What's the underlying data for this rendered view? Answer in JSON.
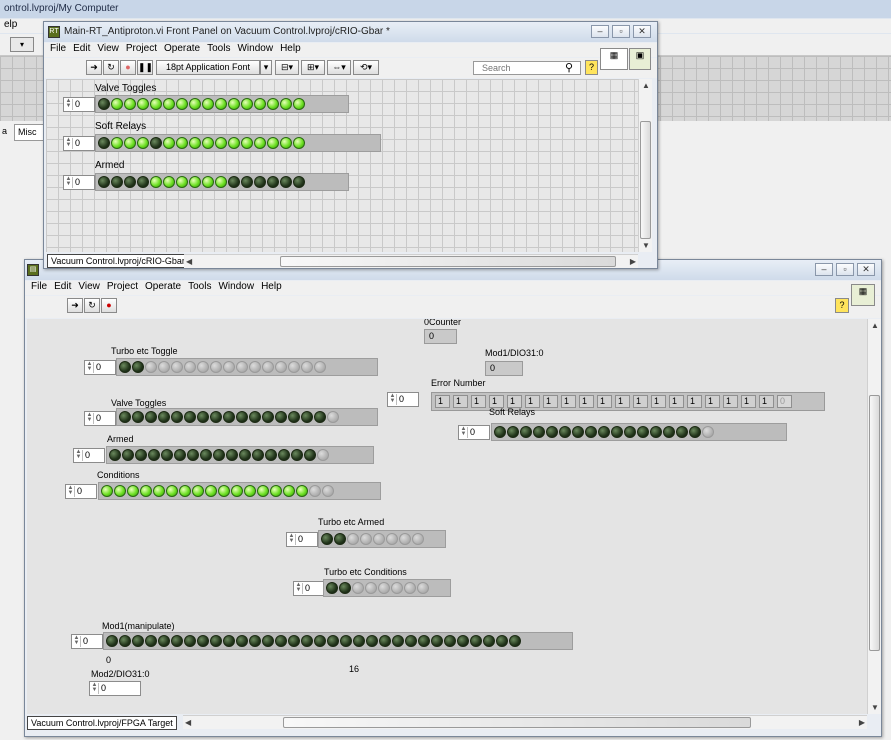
{
  "background_window": {
    "title": "ontrol.lvproj/My Computer",
    "menu_fragment": "elp",
    "tab_a": "a",
    "tab_misc": "Misc"
  },
  "window1": {
    "title": "Main-RT_Antiproton.vi Front Panel on Vacuum Control.lvproj/cRIO-Gbar *",
    "menu": [
      "File",
      "Edit",
      "View",
      "Project",
      "Operate",
      "Tools",
      "Window",
      "Help"
    ],
    "font_selector": "18pt Application Font",
    "search_placeholder": "Search",
    "status": "Vacuum Control.lvproj/cRIO-Gbar",
    "controls": [
      {
        "label": "Valve Toggles",
        "index": "0",
        "leds": "ononononononononononononononon"
      },
      {
        "label": "Soft Relays",
        "index": "0",
        "leds": "ononononononononononononononon"
      },
      {
        "label": "Armed",
        "index": "0",
        "leds": "ononononononononononononononon"
      }
    ]
  },
  "window2": {
    "menu": [
      "File",
      "Edit",
      "View",
      "Project",
      "Operate",
      "Tools",
      "Window",
      "Help"
    ],
    "status": "Vacuum Control.lvproj/FPGA Target",
    "counter": {
      "label": "0Counter",
      "value": "0"
    },
    "mod1_dio": {
      "label": "Mod1/DIO31:0",
      "value": "0"
    },
    "error_number": {
      "label": "Error Number",
      "index": "0",
      "values": [
        "1",
        "1",
        "1",
        "1",
        "1",
        "1",
        "1",
        "1",
        "1",
        "1",
        "1",
        "1",
        "1",
        "1",
        "1",
        "1",
        "1",
        "1",
        "1",
        "0"
      ]
    },
    "controls": {
      "turbo_toggle": {
        "label": "Turbo etc Toggle",
        "index": "0"
      },
      "valve_toggles": {
        "label": "Valve Toggles",
        "index": "0"
      },
      "armed": {
        "label": "Armed",
        "index": "0"
      },
      "conditions": {
        "label": "Conditions",
        "index": "0"
      },
      "soft_relays": {
        "label": "Soft Relays",
        "index": "0"
      },
      "turbo_armed": {
        "label": "Turbo etc Armed",
        "index": "0"
      },
      "turbo_conditions": {
        "label": "Turbo etc Conditions",
        "index": "0"
      },
      "mod1_manipulate": {
        "label": "Mod1(manipulate)",
        "index": "0",
        "scale_start": "0",
        "scale_mid": "16"
      },
      "mod2_dio": {
        "label": "Mod2/DIO31:0",
        "value": "0"
      }
    },
    "led_patterns": {
      "w1_valve": "0111111111111111",
      "w1_soft": "0111011111111111",
      "w1_armed": "0000111111000000",
      "turbo_toggle": "0011111111111111",
      "valve_toggles": "0000000000000000",
      "armed": "0000000000000000",
      "conditions": "1111111111111111",
      "soft_relays": "0000000000000000",
      "turbo_armed": "00111111",
      "turbo_conditions": "00111111",
      "mod1": "00000000000000000000000000000000"
    }
  },
  "colors": {
    "led_on": "#6de023",
    "led_off": "#23361c",
    "led_disabled": "#b3b3b3"
  }
}
